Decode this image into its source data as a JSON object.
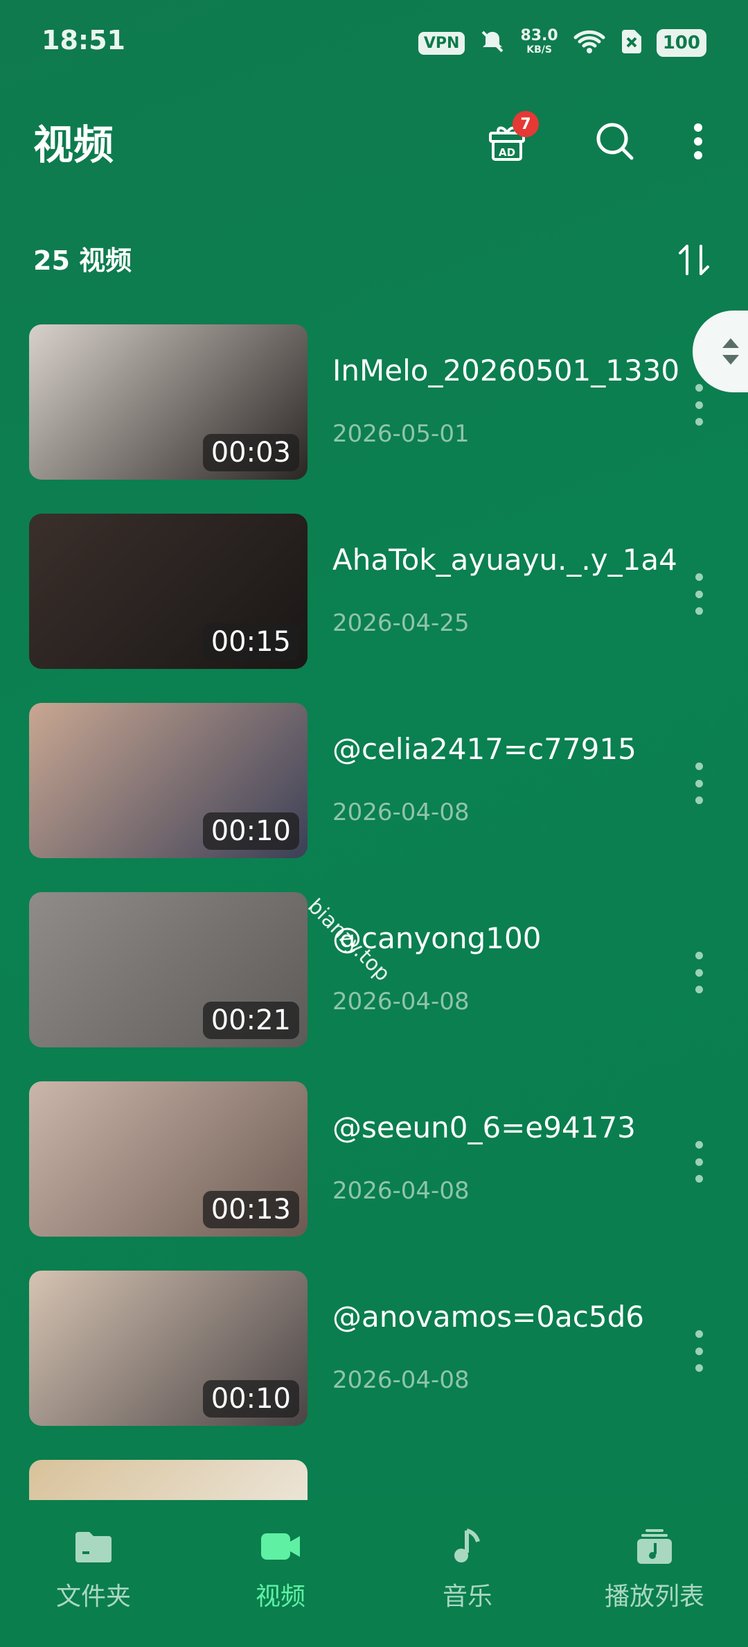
{
  "status_bar": {
    "time": "18:51",
    "vpn": "VPN",
    "speed_value": "83.0",
    "speed_unit": "KB/S",
    "battery": "100"
  },
  "appbar": {
    "title": "视频",
    "gift_badge": "7",
    "gift_ad": "AD"
  },
  "summary": {
    "count_text": "25 视频"
  },
  "videos": [
    {
      "title": "InMelo_20260501_1330",
      "date": "2026-05-01",
      "duration": "00:03",
      "thumb_colors": [
        "#d8d1ca",
        "#2a2624"
      ]
    },
    {
      "title": "AhaTok_ayuayu._.y_1a4",
      "date": "2026-04-25",
      "duration": "00:15",
      "thumb_colors": [
        "#3a2f2b",
        "#1a1716"
      ]
    },
    {
      "title": "@celia2417=c77915",
      "date": "2026-04-08",
      "duration": "00:10",
      "thumb_colors": [
        "#c9a792",
        "#3b3f56"
      ]
    },
    {
      "title": "@canyong100",
      "date": "2026-04-08",
      "duration": "00:21",
      "thumb_colors": [
        "#8f8c8a",
        "#5d5a58"
      ]
    },
    {
      "title": "@seeun0_6=e94173",
      "date": "2026-04-08",
      "duration": "00:13",
      "thumb_colors": [
        "#cbb6aa",
        "#6c5a52"
      ]
    },
    {
      "title": "@anovamos=0ac5d6",
      "date": "2026-04-08",
      "duration": "00:10",
      "thumb_colors": [
        "#d6c3b2",
        "#4a4446"
      ]
    },
    {
      "title": "",
      "date": "",
      "duration": "",
      "thumb_colors": [
        "#d8c29a",
        "#f2f0ec"
      ]
    }
  ],
  "watermark": "bianzy.top",
  "bottom_nav": [
    {
      "label": "文件夹",
      "icon": "folder-icon",
      "active": false
    },
    {
      "label": "视频",
      "icon": "video-camera-icon",
      "active": true
    },
    {
      "label": "音乐",
      "icon": "music-note-icon",
      "active": false
    },
    {
      "label": "播放列表",
      "icon": "playlist-icon",
      "active": false
    }
  ],
  "colors": {
    "background": "#0b8050",
    "accent": "#5ff0a4",
    "badge": "#e53935",
    "date_text": "#8fc5aa"
  }
}
